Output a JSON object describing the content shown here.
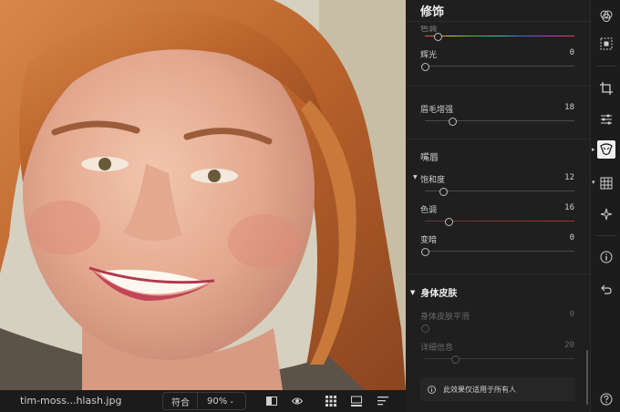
{
  "panel": {
    "title": "修饰",
    "top_cut_label": "色调",
    "rows_top": [
      {
        "label": "辉光",
        "value": "0",
        "fraction": 0.0
      }
    ],
    "brow": {
      "label": "眉毛增强",
      "value": "18",
      "fraction": 0.18
    },
    "lips_title": "嘴唇",
    "lips": [
      {
        "label": "饱和度",
        "value": "12",
        "fraction": 0.12
      },
      {
        "label": "色调",
        "value": "16",
        "fraction": 0.16
      },
      {
        "label": "变暗",
        "value": "0",
        "fraction": 0.0
      }
    ],
    "body_title": "身体皮肤",
    "body": [
      {
        "label": "身体皮肤平滑",
        "value": "0",
        "fraction": 0.0
      },
      {
        "label": "详细信息",
        "value": "20",
        "fraction": 0.2
      }
    ],
    "notice": "此效果仅适用于所有人"
  },
  "bottombar": {
    "filename": "tim-moss...hlash.jpg",
    "fit_label": "符合",
    "zoom": "90%"
  },
  "toolbar": {
    "icons": [
      "color-mixer-icon",
      "select-icon",
      "crop-icon",
      "adjust-sliders-icon",
      "retouch-face-icon",
      "grid-icon",
      "sparkle-icon",
      "info-icon",
      "undo-icon",
      "help-icon"
    ]
  },
  "colors": {
    "panel_bg": "#1f1f1f",
    "accent_active": "#f0f0f0",
    "hue_track_start": "#e04040",
    "lip_tone_track": "#b03030"
  }
}
